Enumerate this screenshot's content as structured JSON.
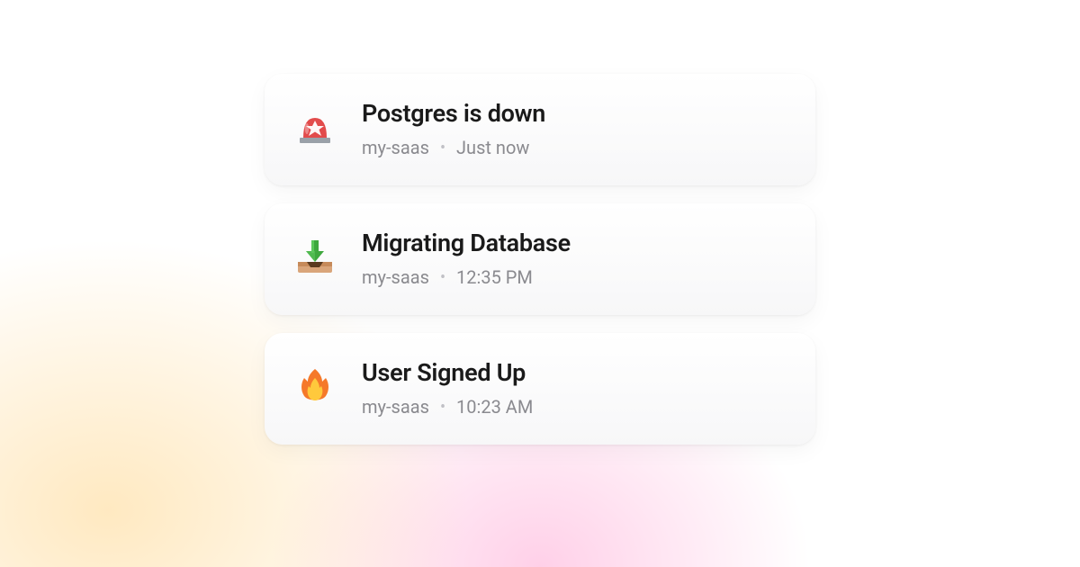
{
  "notifications": [
    {
      "title": "Postgres is down",
      "project": "my-saas",
      "time": "Just now"
    },
    {
      "title": "Migrating Database",
      "project": "my-saas",
      "time": "12:35 PM"
    },
    {
      "title": "User Signed Up",
      "project": "my-saas",
      "time": "10:23 AM"
    }
  ],
  "separator": "•"
}
